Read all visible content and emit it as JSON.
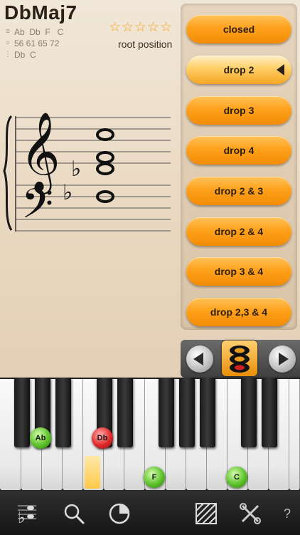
{
  "chord": {
    "name": "DbMaj7",
    "notes_line": "Ab  Db  F   C",
    "midi_line": "56 61 65 72",
    "bass_line": "Db  C",
    "rating": 5,
    "position": "root position"
  },
  "voicings": {
    "items": [
      {
        "label": "closed"
      },
      {
        "label": "drop 2"
      },
      {
        "label": "drop 3"
      },
      {
        "label": "drop 4"
      },
      {
        "label": "drop 2 & 3"
      },
      {
        "label": "drop 2 & 4"
      },
      {
        "label": "drop 3 & 4"
      },
      {
        "label": "drop 2,3 & 4"
      }
    ],
    "selected": "drop 2"
  },
  "keyboard": {
    "notes": [
      "Ab",
      "Db",
      "F",
      "C"
    ]
  },
  "toolbar": {
    "help_label": "?"
  },
  "icons": {
    "info_notes": "bars-icon",
    "info_midi": "circle-icon",
    "info_bass": "steps-icon",
    "toolbar": [
      "notation-icon",
      "search-icon",
      "timer-icon",
      "stripes-icon",
      "tools-icon"
    ]
  },
  "colors": {
    "accent": "#ffa11c",
    "note_green": "#5cc22a",
    "note_red": "#e02a2a",
    "star": "#f7a51a"
  }
}
